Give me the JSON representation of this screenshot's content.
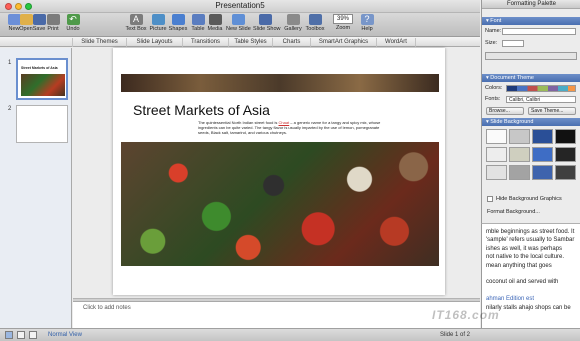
{
  "window": {
    "title": "Presentation5"
  },
  "toolbar": {
    "buttons": [
      {
        "label": "New",
        "icon": "new-icon",
        "color": "#6b8fd8"
      },
      {
        "label": "Open",
        "icon": "open-folder-icon",
        "color": "#e0b04a"
      },
      {
        "label": "Save",
        "icon": "save-icon",
        "color": "#4a6aa8"
      },
      {
        "label": "Print",
        "icon": "print-icon",
        "color": "#7c7c7c"
      },
      {
        "label": "Undo",
        "icon": "undo-icon",
        "color": "#4f9a4a"
      },
      {
        "label": "Text Box",
        "icon": "text-box-icon",
        "color": "#7c7c7c"
      },
      {
        "label": "Picture",
        "icon": "picture-icon",
        "color": "#4e8fc7"
      },
      {
        "label": "Shapes",
        "icon": "shapes-icon",
        "color": "#4a7fd0"
      },
      {
        "label": "Table",
        "icon": "table-icon",
        "color": "#5a7dc0"
      },
      {
        "label": "Media",
        "icon": "media-icon",
        "color": "#5a5a5a"
      },
      {
        "label": "New Slide",
        "icon": "new-slide-icon",
        "color": "#5f8fd6"
      },
      {
        "label": "Slide Show",
        "icon": "slide-show-icon",
        "color": "#4a6aa8"
      },
      {
        "label": "Gallery",
        "icon": "gallery-icon",
        "color": "#8a8a8a"
      },
      {
        "label": "Toolbox",
        "icon": "toolbox-icon",
        "color": "#4f6fa8"
      }
    ],
    "zoom": {
      "label": "Zoom",
      "value": "39%"
    },
    "help_label": "Help"
  },
  "ribbon": {
    "tabs": [
      "Slide Themes",
      "Slide Layouts",
      "Transitions",
      "Table Styles",
      "Charts",
      "SmartArt Graphics",
      "WordArt"
    ]
  },
  "thumbnails": {
    "slides": [
      {
        "number": "1",
        "title": "Street Markets of Asia"
      },
      {
        "number": "2",
        "title": ""
      }
    ]
  },
  "slide": {
    "title": "Street Markets of Asia",
    "body_pre": "The quintessential North Indian street food is ",
    "body_link": "Chaat",
    "body_post": " – a generic name for a tangy and spicy mix, whose ingredients can be quite varied. The tangy flavor is usually imparted by the use of lemon, pomegranate seeds, Black salt, tamarind, and various chutneys."
  },
  "notes": {
    "placeholder": "Click to add notes"
  },
  "status": {
    "view": "Normal View",
    "slide_of": "Slide 1 of 2"
  },
  "palette": {
    "title": "Formatting Palette",
    "font_section": "Font",
    "name_label": "Name:",
    "size_label": "Size:",
    "doc_theme_section": "Document Theme",
    "colors_label": "Colors:",
    "fonts_label": "Fonts:",
    "fonts_value": "Calibri, Calibri",
    "browse_label": "Browse...",
    "save_theme_label": "Save Theme...",
    "bg_section": "Slide Background",
    "swatches": [
      "#fafafa",
      "#c7c7c7",
      "#2a4f97",
      "#111111",
      "#ededed",
      "#cfcfbf",
      "#3e6dc5",
      "#252525",
      "#e2e2e2",
      "#a3a3a3",
      "#3e63ad",
      "#404040"
    ],
    "hide_bg_label": "Hide Background Graphics",
    "format_bg_label": "Format Background..."
  },
  "background_doc": {
    "lines": [
      {
        "text": "mble beginnings as street food. It",
        "link": false
      },
      {
        "text": "'sample' refers usually to Sambar",
        "link": false
      },
      {
        "text": "ishes as well, it was perhaps",
        "link": false
      },
      {
        "text": "not native to the local culture.",
        "link": false
      },
      {
        "text": "mean anything that goes",
        "link": false
      },
      {
        "text": "",
        "link": false
      },
      {
        "text": "coconut oil and served with",
        "link": false
      },
      {
        "text": "",
        "link": false
      },
      {
        "text": "ahman Edition est",
        "link": true
      },
      {
        "text": "nilarly stalls ahajo shops can be",
        "link": false
      }
    ]
  },
  "watermark": "IT168.com"
}
